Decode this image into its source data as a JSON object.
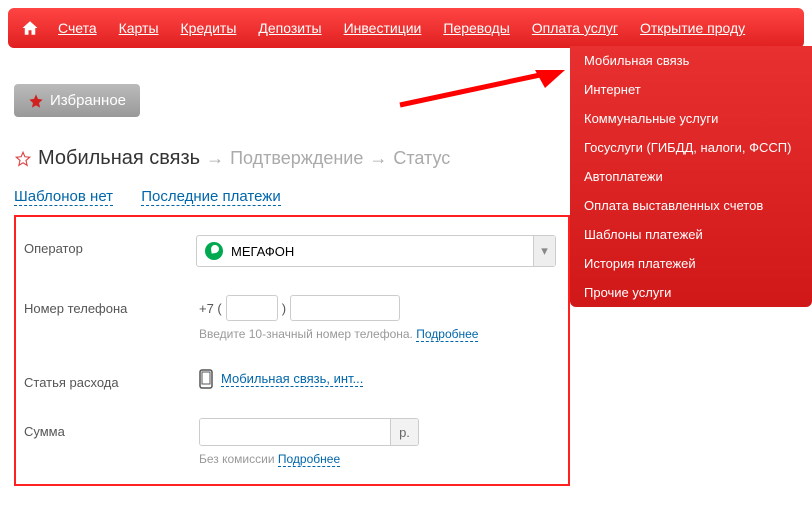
{
  "nav": {
    "items": [
      "Счета",
      "Карты",
      "Кредиты",
      "Депозиты",
      "Инвестиции",
      "Переводы",
      "Оплата услуг",
      "Открытие проду"
    ]
  },
  "dropdown": {
    "items": [
      "Мобильная связь",
      "Интернет",
      "Коммунальные услуги",
      "Госуслуги (ГИБДД, налоги, ФССП)",
      "Автоплатежи",
      "Оплата выставленных счетов",
      "Шаблоны платежей",
      "История платежей",
      "Прочие услуги"
    ]
  },
  "favorite_btn": "Избранное",
  "breadcrumb": {
    "current": "Мобильная связь",
    "steps": [
      "Подтверждение",
      "Статус"
    ]
  },
  "tabs": {
    "templates": "Шаблонов нет",
    "recent": "Последние платежи"
  },
  "form": {
    "operator": {
      "label": "Оператор",
      "value": "МЕГАФОН"
    },
    "phone": {
      "label": "Номер телефона",
      "prefix": "+7 (",
      "sep": ")",
      "helper": "Введите 10-значный номер телефона.",
      "more": "Подробнее"
    },
    "expense": {
      "label": "Статья расхода",
      "link": "Мобильная связь, инт..."
    },
    "amount": {
      "label": "Сумма",
      "suffix": "р.",
      "helper": "Без комиссии",
      "more": "Подробнее"
    }
  }
}
